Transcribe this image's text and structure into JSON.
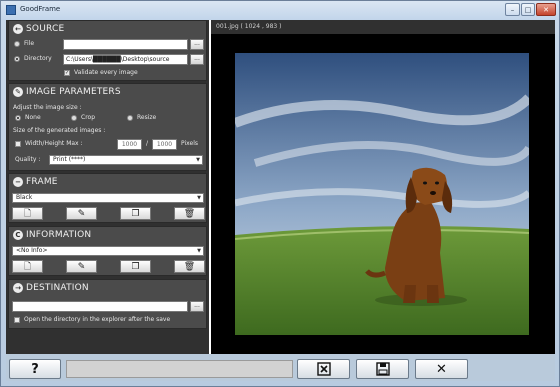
{
  "window": {
    "title": "GoodFrame",
    "min_glyph": "–",
    "max_glyph": "□",
    "close_glyph": "✕"
  },
  "source": {
    "title": "SOURCE",
    "file_label": "File",
    "file_value": "",
    "directory_label": "Directory",
    "directory_value": "C:\\Users\\██████\\Desktop\\source",
    "browse_label": "...",
    "validate_label": "Validate every image",
    "validate_checked": true
  },
  "image_params": {
    "title": "IMAGE PARAMETERS",
    "adjust_label": "Adjust the image size :",
    "options": [
      "None",
      "Crop",
      "Resize"
    ],
    "selected_option": "None",
    "size_label": "Size of the generated images :",
    "max_label": "Width/Height Max :",
    "width_value": "1000",
    "slash": "/",
    "height_value": "1000",
    "unit": "Pixels",
    "quality_label": "Quality :",
    "quality_value": "Print (****)"
  },
  "frame": {
    "title": "FRAME",
    "selected": "Black"
  },
  "information": {
    "title": "INFORMATION",
    "selected": "<No Info>"
  },
  "destination": {
    "title": "DESTINATION",
    "path_value": "",
    "browse_label": "...",
    "open_dir_label": "Open the directory in the explorer after the save"
  },
  "preview": {
    "file_label": "001.jpg ( 1024 , 983 )"
  },
  "bottom": {
    "help_label": "?",
    "cancel_glyph": "✕"
  },
  "colors": {
    "panel_bg": "#303030",
    "section_bg": "#4b4b4b",
    "preview_bg": "#000000",
    "bottom_bar": "#b9cadb"
  }
}
